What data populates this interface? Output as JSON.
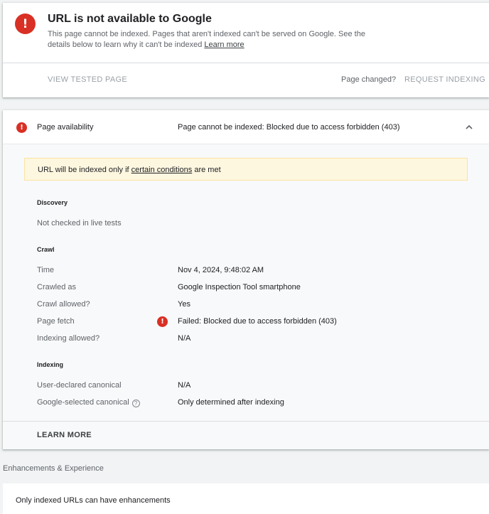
{
  "summary": {
    "title": "URL is not available to Google",
    "description": "This page cannot be indexed. Pages that aren't indexed can't be served on Google. See the details below to learn why it can't be indexed",
    "learn_more_link": "Learn more",
    "view_tested_page": "VIEW TESTED PAGE",
    "page_changed": "Page changed?",
    "request_indexing": "REQUEST INDEXING"
  },
  "availability": {
    "label": "Page availability",
    "status": "Page cannot be indexed: Blocked due to access forbidden (403)",
    "banner": {
      "prefix": "URL will be indexed only if",
      "link": "certain conditions",
      "suffix": "are met"
    },
    "discovery": {
      "title": "Discovery",
      "note": "Not checked in live tests"
    },
    "crawl": {
      "title": "Crawl",
      "rows": [
        {
          "label": "Time",
          "value": "Nov 4, 2024, 9:48:02 AM"
        },
        {
          "label": "Crawled as",
          "value": "Google Inspection Tool smartphone"
        },
        {
          "label": "Crawl allowed?",
          "value": "Yes"
        },
        {
          "label": "Page fetch",
          "value": "Failed: Blocked due to access forbidden (403)"
        },
        {
          "label": "Indexing allowed?",
          "value": "N/A"
        }
      ]
    },
    "indexing": {
      "title": "Indexing",
      "rows": [
        {
          "label": "User-declared canonical",
          "value": "N/A"
        },
        {
          "label": "Google-selected canonical",
          "value": "Only determined after indexing"
        }
      ]
    },
    "learn_more": "LEARN MORE"
  },
  "enhancements": {
    "heading": "Enhancements & Experience",
    "message": "Only indexed URLs can have enhancements"
  },
  "colors": {
    "error": "#d93025",
    "banner_bg": "#fef7e0",
    "disabled_text": "#9aa0a6"
  },
  "icons": {
    "error": "!",
    "help": "?"
  }
}
